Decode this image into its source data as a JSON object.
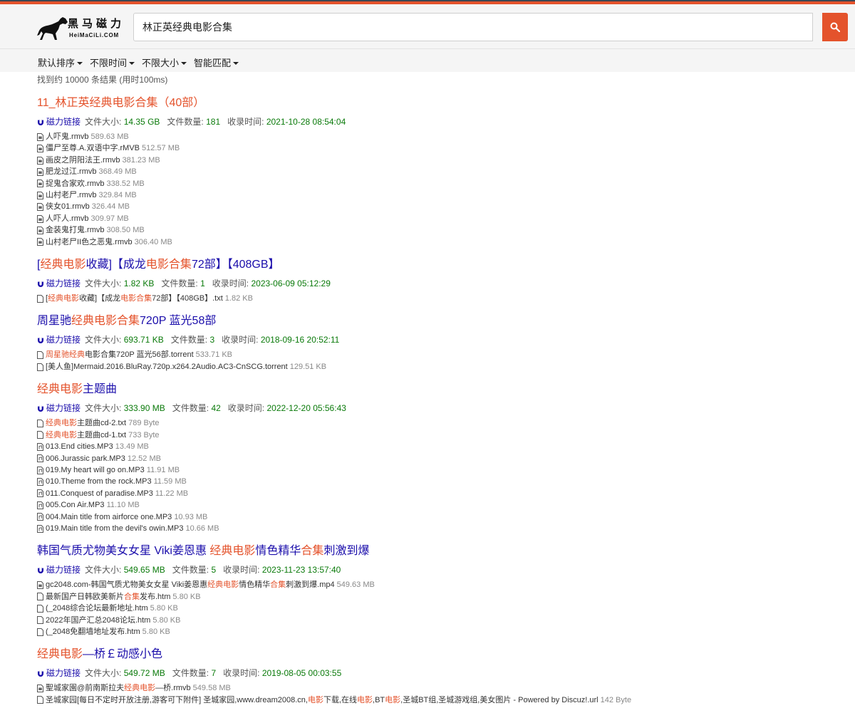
{
  "colors": {
    "accent": "#e4532c",
    "link": "#1a0dab",
    "meta_value": "#0a7a0a"
  },
  "logo": {
    "cn": "黑马磁力",
    "en": "HeiMaCiLi.COM"
  },
  "search": {
    "query": "林正英经典电影合集"
  },
  "filters": [
    "默认排序",
    "不限时间",
    "不限大小",
    "智能匹配"
  ],
  "stats": "找到约 10000 条结果 (用时100ms)",
  "meta_labels": {
    "magnet": "磁力链接",
    "size": "文件大小:",
    "count": "文件数量:",
    "time": "收录时间:"
  },
  "results": [
    {
      "title": [
        {
          "t": "11_林正英经典电影合集（40部）",
          "h": true
        }
      ],
      "size": "14.35 GB",
      "count": "181",
      "time": "2021-10-28 08:54:04",
      "files": [
        {
          "icon": "video-file-icon",
          "name": [
            {
              "t": "人吓鬼.rmvb",
              "h": false
            }
          ],
          "size": "589.63 MB"
        },
        {
          "icon": "video-file-icon",
          "name": [
            {
              "t": "僵尸至尊.A.双语中字.rMVB",
              "h": false
            }
          ],
          "size": "512.57 MB"
        },
        {
          "icon": "video-file-icon",
          "name": [
            {
              "t": "画皮之阴阳法王.rmvb",
              "h": false
            }
          ],
          "size": "381.23 MB"
        },
        {
          "icon": "video-file-icon",
          "name": [
            {
              "t": "肥龙过江.rmvb",
              "h": false
            }
          ],
          "size": "368.49 MB"
        },
        {
          "icon": "video-file-icon",
          "name": [
            {
              "t": "捉鬼合家欢.rmvb",
              "h": false
            }
          ],
          "size": "338.52 MB"
        },
        {
          "icon": "video-file-icon",
          "name": [
            {
              "t": "山村老尸.rmvb",
              "h": false
            }
          ],
          "size": "329.84 MB"
        },
        {
          "icon": "video-file-icon",
          "name": [
            {
              "t": "侠女01.rmvb",
              "h": false
            }
          ],
          "size": "326.44 MB"
        },
        {
          "icon": "video-file-icon",
          "name": [
            {
              "t": "人吓人.rmvb",
              "h": false
            }
          ],
          "size": "309.97 MB"
        },
        {
          "icon": "video-file-icon",
          "name": [
            {
              "t": "金装鬼打鬼.rmvb",
              "h": false
            }
          ],
          "size": "308.50 MB"
        },
        {
          "icon": "video-file-icon",
          "name": [
            {
              "t": "山村老尸II色之恶鬼.rmvb",
              "h": false
            }
          ],
          "size": "306.40 MB"
        }
      ]
    },
    {
      "title": [
        {
          "t": "[",
          "h": false
        },
        {
          "t": "经典电影",
          "h": true
        },
        {
          "t": "收藏]【成龙",
          "h": false
        },
        {
          "t": "电影合集",
          "h": true
        },
        {
          "t": "72部】【408GB】",
          "h": false
        }
      ],
      "size": "1.82 KB",
      "count": "1",
      "time": "2023-06-09 05:12:29",
      "files": [
        {
          "icon": "text-file-icon",
          "name": [
            {
              "t": "[",
              "h": false
            },
            {
              "t": "经典电影",
              "h": true
            },
            {
              "t": "收藏]【成龙",
              "h": false
            },
            {
              "t": "电影合集",
              "h": true
            },
            {
              "t": "72部】【408GB】.txt",
              "h": false
            }
          ],
          "size": "1.82 KB"
        }
      ]
    },
    {
      "title": [
        {
          "t": "周星驰",
          "h": false
        },
        {
          "t": "经典电影合集",
          "h": true
        },
        {
          "t": "720P 蓝光58部",
          "h": false
        }
      ],
      "size": "693.71 KB",
      "count": "3",
      "time": "2018-09-16 20:52:11",
      "files": [
        {
          "icon": "text-file-icon",
          "name": [
            {
              "t": "周星驰经典",
              "h": true
            },
            {
              "t": "电影合集720P 蓝光56部.torrent",
              "h": false
            }
          ],
          "size": "533.71 KB"
        },
        {
          "icon": "text-file-icon",
          "name": [
            {
              "t": "[美人鱼]Mermaid.2016.BluRay.720p.x264.2Audio.AC3-CnSCG.torrent",
              "h": false
            }
          ],
          "size": "129.51 KB"
        }
      ]
    },
    {
      "title": [
        {
          "t": "经典电影",
          "h": true
        },
        {
          "t": "主题曲",
          "h": false
        }
      ],
      "size": "333.90 MB",
      "count": "42",
      "time": "2022-12-20 05:56:43",
      "files": [
        {
          "icon": "text-file-icon",
          "name": [
            {
              "t": "经典电影",
              "h": true
            },
            {
              "t": "主题曲cd-2.txt",
              "h": false
            }
          ],
          "size": "789 Byte"
        },
        {
          "icon": "text-file-icon",
          "name": [
            {
              "t": "经典电影",
              "h": true
            },
            {
              "t": "主题曲cd-1.txt",
              "h": false
            }
          ],
          "size": "733 Byte"
        },
        {
          "icon": "audio-file-icon",
          "name": [
            {
              "t": "013.End cities.MP3",
              "h": false
            }
          ],
          "size": "13.49 MB"
        },
        {
          "icon": "audio-file-icon",
          "name": [
            {
              "t": "006.Jurassic park.MP3",
              "h": false
            }
          ],
          "size": "12.52 MB"
        },
        {
          "icon": "audio-file-icon",
          "name": [
            {
              "t": "019.My heart will go on.MP3",
              "h": false
            }
          ],
          "size": "11.91 MB"
        },
        {
          "icon": "audio-file-icon",
          "name": [
            {
              "t": "010.Theme from the rock.MP3",
              "h": false
            }
          ],
          "size": "11.59 MB"
        },
        {
          "icon": "audio-file-icon",
          "name": [
            {
              "t": "011.Conquest of paradise.MP3",
              "h": false
            }
          ],
          "size": "11.22 MB"
        },
        {
          "icon": "audio-file-icon",
          "name": [
            {
              "t": "005.Con Air.MP3",
              "h": false
            }
          ],
          "size": "11.10 MB"
        },
        {
          "icon": "audio-file-icon",
          "name": [
            {
              "t": "004.Main title from airforce one.MP3",
              "h": false
            }
          ],
          "size": "10.93 MB"
        },
        {
          "icon": "audio-file-icon",
          "name": [
            {
              "t": "019.Main title from the devil's owin.MP3",
              "h": false
            }
          ],
          "size": "10.66 MB"
        }
      ]
    },
    {
      "title": [
        {
          "t": "韩国气质尤物美女女星 Viki姜恩惠 ",
          "h": false
        },
        {
          "t": "经典电影",
          "h": true
        },
        {
          "t": "情色精华",
          "h": false
        },
        {
          "t": "合集",
          "h": true
        },
        {
          "t": "刺激到爆",
          "h": false
        }
      ],
      "size": "549.65 MB",
      "count": "5",
      "time": "2023-11-23 13:57:40",
      "files": [
        {
          "icon": "video-file-icon",
          "name": [
            {
              "t": "gc2048.com-韩国气质尤物美女女星 Viki姜恩惠 ",
              "h": false
            },
            {
              "t": "经典电影",
              "h": true
            },
            {
              "t": "情色精华",
              "h": false
            },
            {
              "t": "合集",
              "h": true
            },
            {
              "t": "刺激到爆.mp4",
              "h": false
            }
          ],
          "size": "549.63 MB"
        },
        {
          "icon": "text-file-icon",
          "name": [
            {
              "t": "最新国产日韩欧美新片",
              "h": false
            },
            {
              "t": "合集",
              "h": true
            },
            {
              "t": "发布.htm",
              "h": false
            }
          ],
          "size": "5.80 KB"
        },
        {
          "icon": "text-file-icon",
          "name": [
            {
              "t": "(_2048综合论坛最新地址.htm",
              "h": false
            }
          ],
          "size": "5.80 KB"
        },
        {
          "icon": "text-file-icon",
          "name": [
            {
              "t": "2022年国产汇总2048论坛.htm",
              "h": false
            }
          ],
          "size": "5.80 KB"
        },
        {
          "icon": "text-file-icon",
          "name": [
            {
              "t": "(_2048免翻墙地址发布.htm",
              "h": false
            }
          ],
          "size": "5.80 KB"
        }
      ]
    },
    {
      "title": [
        {
          "t": "经典电影",
          "h": true
        },
        {
          "t": "—桥￡动感小色",
          "h": false
        }
      ],
      "size": "549.72 MB",
      "count": "7",
      "time": "2019-08-05 00:03:55",
      "files": [
        {
          "icon": "video-file-icon",
          "name": [
            {
              "t": "聖城家園@前南斯拉夫",
              "h": false
            },
            {
              "t": "经典电影",
              "h": true
            },
            {
              "t": "—桥.rmvb",
              "h": false
            }
          ],
          "size": "549.58 MB"
        },
        {
          "icon": "text-file-icon",
          "name": [
            {
              "t": "圣城家园[每日不定时开放注册,游客可下附件] 圣城家园,www.dream2008.cn,",
              "h": false
            },
            {
              "t": "电影",
              "h": true
            },
            {
              "t": "下载,在线",
              "h": false
            },
            {
              "t": "电影",
              "h": true
            },
            {
              "t": ",BT",
              "h": false
            },
            {
              "t": "电影",
              "h": true
            },
            {
              "t": ",圣城BT组,圣城游戏组,美女图片 - Powered by Discuz!.url",
              "h": false
            }
          ],
          "size": "142 Byte"
        }
      ]
    }
  ]
}
